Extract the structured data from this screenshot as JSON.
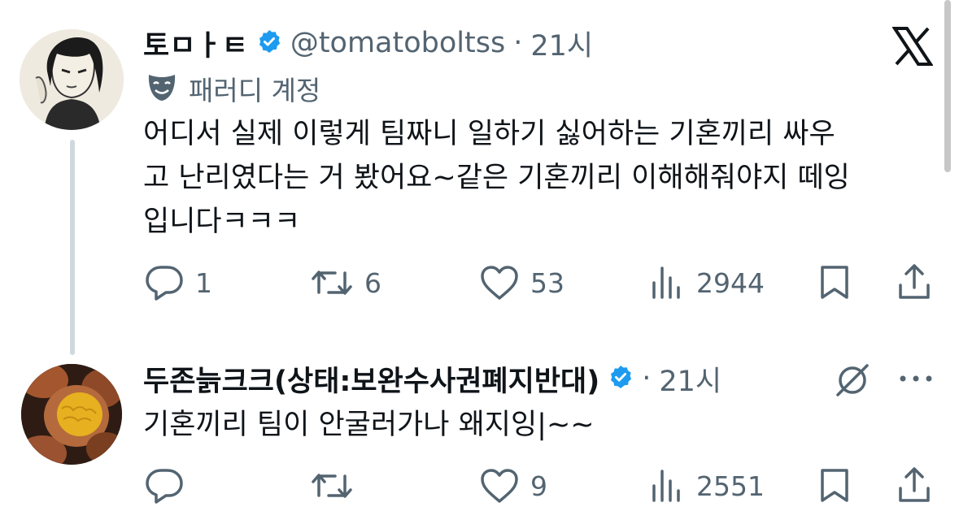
{
  "tweets": [
    {
      "display_name": "토ㅁㅏㅌ",
      "handle": "@tomatoboltss",
      "separator": "·",
      "time": "21시",
      "label": "패러디 계정",
      "text_lines": [
        "어디서 실제 이렇게 팀짜니 일하기 싫어하는 기혼끼리 싸우",
        "고 난리였다는 거 봤어요~같은 기혼끼리 이해해줘야지 떼잉",
        "입니다ㅋㅋㅋ"
      ],
      "stats": {
        "replies": "1",
        "retweets": "6",
        "likes": "53",
        "views": "2944"
      }
    },
    {
      "display_name": "두존늙크크(상태:보완수사권폐지반대)",
      "separator": "·",
      "time": "21시",
      "text_lines": [
        "기혼끼리 팀이 안굴러가나 왜지잉|~~"
      ],
      "stats": {
        "replies": "",
        "retweets": "",
        "likes": "9",
        "views": "2551"
      }
    }
  ],
  "colors": {
    "verified": "#1d9bf0",
    "muted": "#536471",
    "text": "#0f1419",
    "thread_line": "#cfd9de"
  },
  "icons": [
    "x-logo-icon",
    "verified-badge-icon",
    "parody-mask-icon",
    "reply-icon",
    "retweet-icon",
    "like-icon",
    "views-icon",
    "bookmark-icon",
    "share-icon",
    "grok-icon",
    "more-icon"
  ]
}
